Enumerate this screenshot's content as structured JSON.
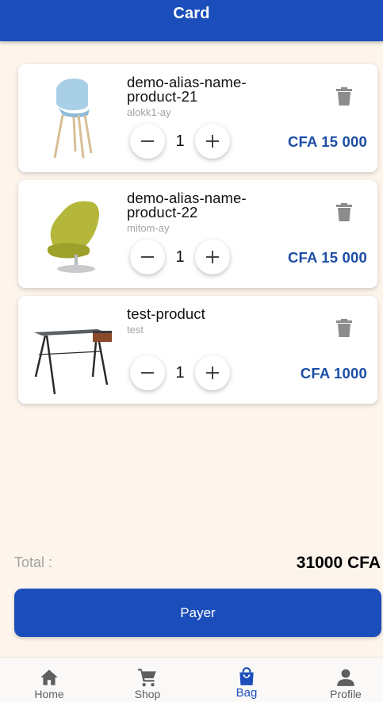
{
  "colors": {
    "primary": "#1c4ebb",
    "price": "#1c4ea6",
    "background": "#fdf5eb",
    "muted": "#a3a3a3"
  },
  "header": {
    "title": "Card"
  },
  "cart": {
    "items": [
      {
        "name_line1": "demo-alias-name-",
        "name_line2": "product-21",
        "alias": "alokk1-ay",
        "quantity": "1",
        "price": "CFA 15 000",
        "image": "blue-chair"
      },
      {
        "name_line1": "demo-alias-name-",
        "name_line2": "product-22",
        "alias": "mitom-ay",
        "quantity": "1",
        "price": "CFA 15 000",
        "image": "green-swivel-chair"
      },
      {
        "name_line1": "test-product",
        "alias": "test",
        "quantity": "1",
        "price": "CFA 1000",
        "image": "desk"
      }
    ]
  },
  "summary": {
    "total_label": "Total :",
    "total_value": "31000 CFA"
  },
  "pay_button": {
    "label": "Payer"
  },
  "bottom_nav": {
    "items": [
      {
        "label": "Home",
        "icon": "home-icon"
      },
      {
        "label": "Shop",
        "icon": "shopping-cart-icon"
      },
      {
        "label": "Bag",
        "icon": "shopping-bag-icon",
        "active": true
      },
      {
        "label": "Profile",
        "icon": "person-icon"
      }
    ]
  }
}
